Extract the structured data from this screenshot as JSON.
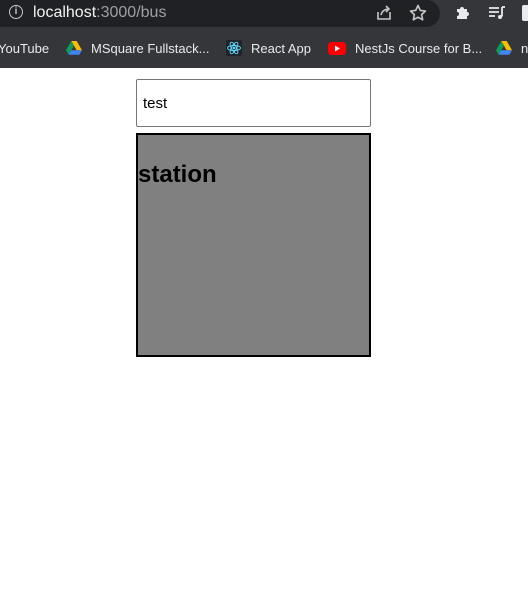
{
  "browser": {
    "url_host": "localhost",
    "url_path": ":3000/bus",
    "bookmarks": [
      {
        "label": "YouTube",
        "icon": "none"
      },
      {
        "label": "MSquare Fullstack...",
        "icon": "google-drive-icon"
      },
      {
        "label": "React App",
        "icon": "react-icon"
      },
      {
        "label": "NestJs Course for B...",
        "icon": "youtube-icon"
      },
      {
        "label": "n",
        "icon": "google-drive-icon"
      }
    ]
  },
  "page": {
    "input_value": "test",
    "station_heading": "station"
  },
  "colors": {
    "chrome_bg": "#35363a",
    "addressbar_bg": "#202124",
    "station_bg": "#808080"
  }
}
